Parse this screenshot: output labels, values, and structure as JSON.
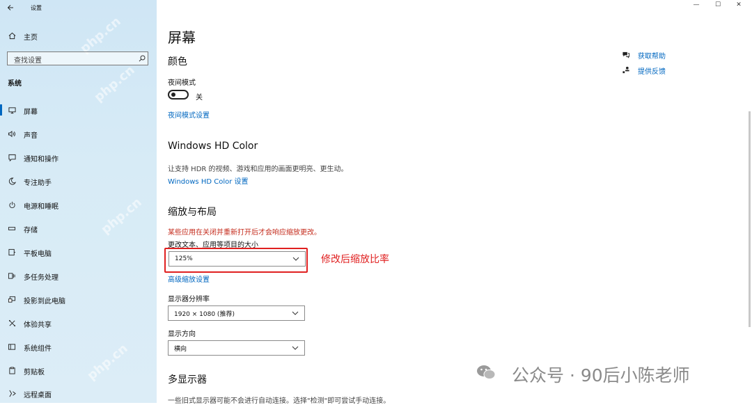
{
  "window": {
    "title": "设置",
    "controls": {
      "minimize": "—",
      "maximize": "☐",
      "close": "✕"
    }
  },
  "sidebar": {
    "home": "主页",
    "search_placeholder": "查找设置",
    "section_label": "系统",
    "items": [
      {
        "label": "屏幕",
        "icon": "monitor-icon"
      },
      {
        "label": "声音",
        "icon": "speaker-icon"
      },
      {
        "label": "通知和操作",
        "icon": "notification-icon"
      },
      {
        "label": "专注助手",
        "icon": "moon-icon"
      },
      {
        "label": "电源和睡眠",
        "icon": "power-icon"
      },
      {
        "label": "存储",
        "icon": "storage-icon"
      },
      {
        "label": "平板电脑",
        "icon": "tablet-icon"
      },
      {
        "label": "多任务处理",
        "icon": "multitask-icon"
      },
      {
        "label": "投影到此电脑",
        "icon": "project-icon"
      },
      {
        "label": "体验共享",
        "icon": "share-icon"
      },
      {
        "label": "系统组件",
        "icon": "components-icon"
      },
      {
        "label": "剪贴板",
        "icon": "clipboard-icon"
      },
      {
        "label": "远程桌面",
        "icon": "remote-desktop-icon"
      }
    ]
  },
  "main": {
    "title": "屏幕",
    "color_section": "颜色",
    "night_light_label": "夜间模式",
    "night_light_state": "关",
    "night_light_settings": "夜间模式设置",
    "hd_section": "Windows HD Color",
    "hd_desc": "让支持 HDR 的视频、游戏和应用的画面更明亮、更生动。",
    "hd_link": "Windows HD Color 设置",
    "scale_section": "缩放与布局",
    "scale_warning": "某些应用在关闭并重新打开后才会响应缩放更改。",
    "scale_label": "更改文本、应用等项目的大小",
    "scale_value": "125%",
    "annotation": "修改后缩放比率",
    "advanced_scaling": "高级缩放设置",
    "resolution_label": "显示器分辨率",
    "resolution_value": "1920 × 1080 (推荐)",
    "orientation_label": "显示方向",
    "orientation_value": "横向",
    "multi_display_section": "多显示器",
    "multi_display_desc": "一些旧式显示器可能不会进行自动连接。选择\"检测\"即可尝试手动连接。"
  },
  "help": {
    "get_help": "获取帮助",
    "feedback": "提供反馈"
  },
  "watermark": {
    "brand": "公众号 · 90后小陈老师",
    "site": "php.cn"
  },
  "colors": {
    "accent": "#0067c0",
    "warning": "#c42b1c",
    "annotation": "#e02020"
  }
}
